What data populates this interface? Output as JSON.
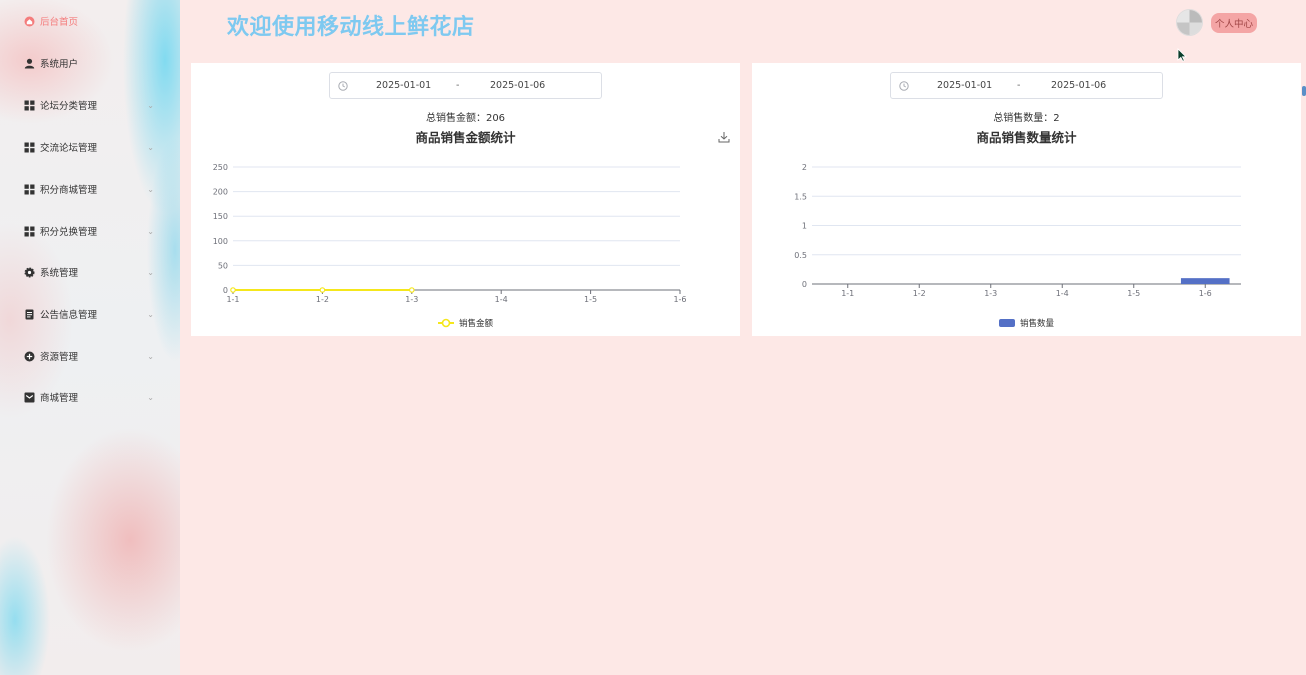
{
  "header": {
    "title": "欢迎使用移动线上鲜花店",
    "profile_label": "个人中心"
  },
  "sidebar": {
    "items": [
      {
        "label": "后台首页",
        "icon": "home-icon",
        "active": true
      },
      {
        "label": "系统用户",
        "icon": "user-icon"
      },
      {
        "label": "论坛分类管理",
        "icon": "grid-icon"
      },
      {
        "label": "交流论坛管理",
        "icon": "grid-icon"
      },
      {
        "label": "积分商城管理",
        "icon": "grid-icon"
      },
      {
        "label": "积分兑换管理",
        "icon": "grid-icon"
      },
      {
        "label": "系统管理",
        "icon": "gear-icon"
      },
      {
        "label": "公告信息管理",
        "icon": "document-icon"
      },
      {
        "label": "资源管理",
        "icon": "plus-circle-icon"
      },
      {
        "label": "商城管理",
        "icon": "mail-icon"
      }
    ]
  },
  "cards": {
    "left": {
      "date_start": "2025-01-01",
      "date_sep": "-",
      "date_end": "2025-01-06",
      "total_text": "总销售金额：206"
    },
    "right": {
      "date_start": "2025-01-01",
      "date_sep": "-",
      "date_end": "2025-01-06",
      "total_text": "总销售数量：2"
    }
  },
  "colors": {
    "accent_title": "#7ec9f0",
    "line_series": "#f5e71b",
    "bar_series": "#5470c6",
    "sidebar_active": "#f47c7c"
  },
  "chart_data": [
    {
      "type": "line",
      "title": "商品销售金额统计",
      "categories": [
        "1-1",
        "1-2",
        "1-3",
        "1-4",
        "1-5",
        "1-6"
      ],
      "series": [
        {
          "name": "销售金额",
          "values": [
            0,
            0,
            0,
            null,
            null,
            null
          ]
        }
      ],
      "yticks": [
        0,
        50,
        100,
        150,
        200,
        250
      ],
      "ylim": [
        0,
        250
      ],
      "grid": true,
      "legend": "bottom-center"
    },
    {
      "type": "bar",
      "title": "商品销售数量统计",
      "categories": [
        "1-1",
        "1-2",
        "1-3",
        "1-4",
        "1-5",
        "1-6"
      ],
      "series": [
        {
          "name": "销售数量",
          "values": [
            0,
            0,
            0,
            0,
            0,
            0.1
          ]
        }
      ],
      "yticks": [
        0,
        0.5,
        1,
        1.5,
        2
      ],
      "ylim": [
        0,
        2
      ],
      "grid": true,
      "legend": "bottom-center"
    }
  ]
}
